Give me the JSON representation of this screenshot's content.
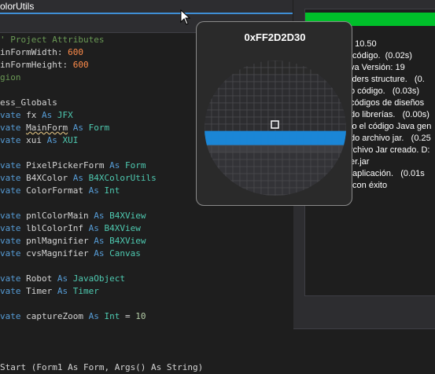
{
  "tab": {
    "title": "olorUtils"
  },
  "editor": {
    "lines": [
      {
        "t": "' Project Attributes",
        "cls": "cm"
      },
      {
        "a": "inFormWidth: ",
        "b": "600"
      },
      {
        "a": "inFormHeight: ",
        "b": "600"
      },
      {
        "t": "gion",
        "cls": "cm"
      },
      {
        "t": "",
        "cls": "pl"
      },
      {
        "t": "ess_Globals",
        "cls": "pl"
      },
      {
        "a": "vate ",
        "b": "fx",
        "c": " As ",
        "d": "JFX"
      },
      {
        "a": "vate ",
        "b": "MainForm",
        "c": " As ",
        "d": "Form"
      },
      {
        "a": "vate ",
        "b": "xui",
        "c": " As ",
        "d": "XUI"
      },
      {
        "t": "",
        "cls": "pl"
      },
      {
        "a": "vate ",
        "b": "PixelPickerForm",
        "c": " As ",
        "d": "Form"
      },
      {
        "a": "vate ",
        "b": "B4XColor",
        "c": " As ",
        "d": "B4XColorUtils"
      },
      {
        "a": "vate ",
        "b": "ColorFormat",
        "c": " As ",
        "d": "Int"
      },
      {
        "t": "",
        "cls": "pl"
      },
      {
        "a": "vate ",
        "b": "pnlColorMain",
        "c": " As ",
        "d": "B4XView"
      },
      {
        "a": "vate ",
        "b": "lblColorInf",
        "c": " As ",
        "d": "B4XView"
      },
      {
        "a": "vate ",
        "b": "pnlMagnifier",
        "c": " As ",
        "d": "B4XView"
      },
      {
        "a": "vate ",
        "b": "cvsMagnifier",
        "c": " As ",
        "d": "Canvas"
      },
      {
        "t": "",
        "cls": "pl"
      },
      {
        "a": "vate ",
        "b": "Robot",
        "c": " As ",
        "d": "JavaObject"
      },
      {
        "a": "vate ",
        "b": "Timer",
        "c": " As ",
        "d": "Timer"
      },
      {
        "t": "",
        "cls": "pl"
      },
      {
        "a": "vate ",
        "b": "captureZoom",
        "c": " As ",
        "d": "Int",
        "e": " = ",
        "f": "10"
      }
    ],
    "last_line": "Start (Form1 As Form, Args() As String)"
  },
  "log": {
    "lines": [
      ": 10.50",
      " código.  (0.02s)",
      "va Versión: 19",
      "lders structure.   (0.",
      "o código.   (0.03s)",
      "códigos de diseños",
      "do librerías.   (0.00s)",
      "lo el código Java gen",
      "do archivo jar.   (0.25",
      "rchivo Jar creado. D:",
      "er.jar",
      " aplicación.   (0.01s",
      " con éxito"
    ]
  },
  "popup": {
    "title": "0xFF2D2D30",
    "colors": {
      "highlight": "#1b86d6",
      "border": "#8a8a8a"
    }
  }
}
